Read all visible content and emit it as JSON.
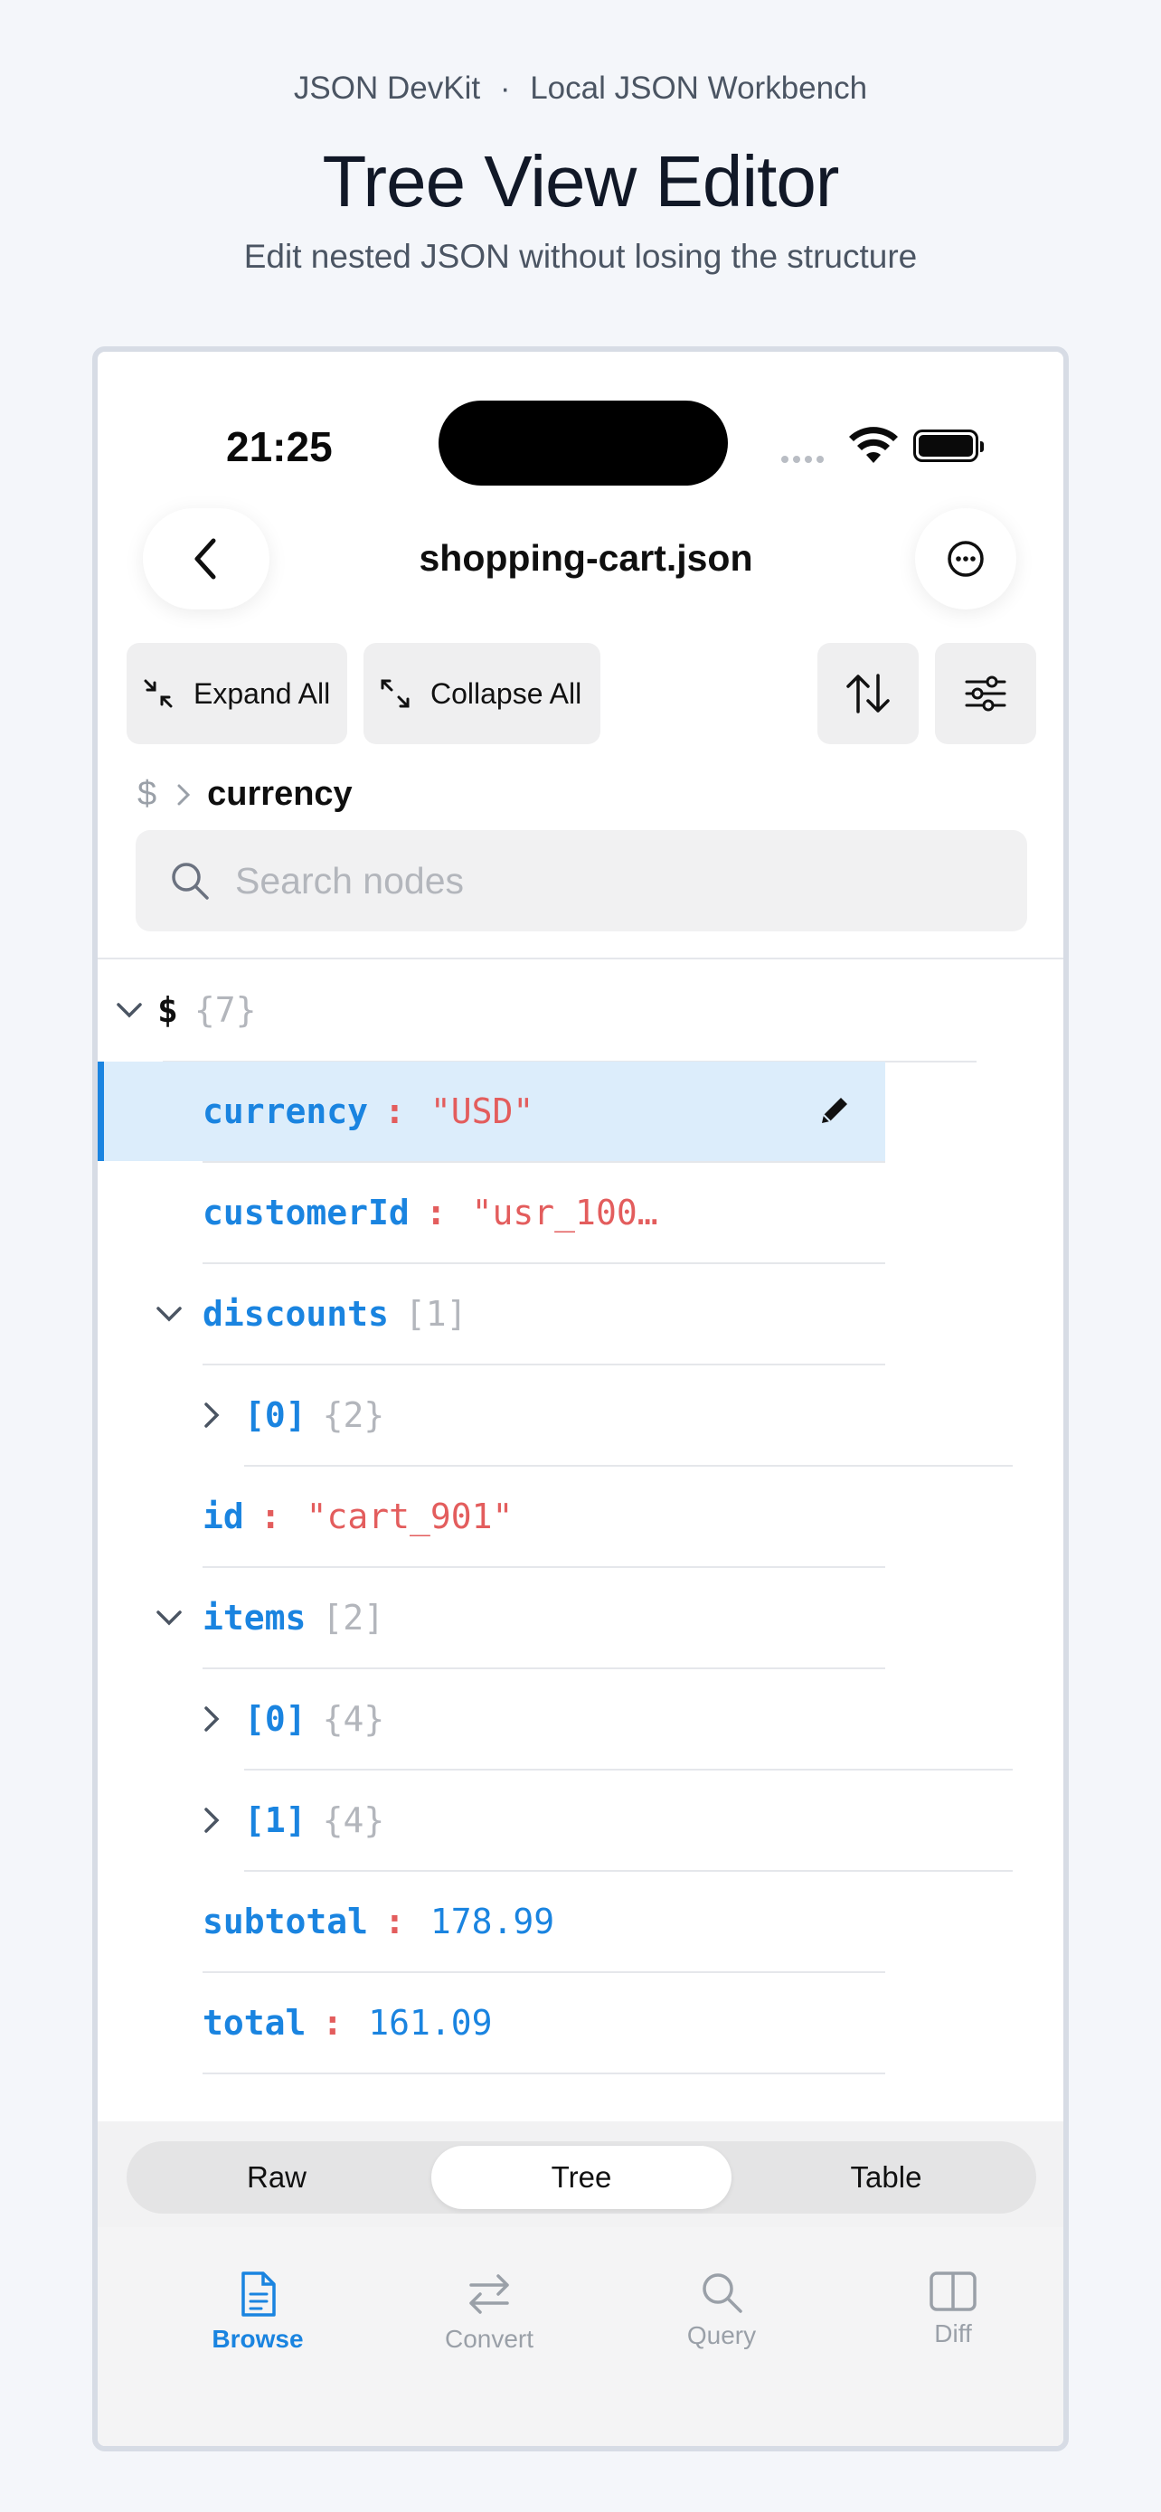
{
  "header": {
    "brand": "JSON DevKit",
    "brand_sep": "·",
    "brand_tag": "Local JSON Workbench",
    "title": "Tree View Editor",
    "subtitle": "Edit nested JSON without losing the structure"
  },
  "status": {
    "time": "21:25"
  },
  "nav": {
    "title": "shopping-cart.json",
    "back_icon": "chevron-left-icon",
    "more_icon": "ellipsis-circle-icon"
  },
  "toolbar": {
    "expand_label": "Expand All",
    "collapse_label": "Collapse All"
  },
  "breadcrumb": {
    "root": "$",
    "current": "currency"
  },
  "search": {
    "placeholder": "Search nodes"
  },
  "tree": {
    "root": {
      "key": "$",
      "count": "{7}"
    },
    "rows": [
      {
        "key": "currency",
        "sep": ":",
        "value": "\"USD\"",
        "selected": true
      },
      {
        "key": "customerId",
        "sep": ":",
        "value": "\"usr_100…"
      },
      {
        "key": "discounts",
        "count": "[1]"
      },
      {
        "key": "[0]",
        "count": "{2}"
      },
      {
        "key": "id",
        "sep": ":",
        "value": "\"cart_901\""
      },
      {
        "key": "items",
        "count": "[2]"
      },
      {
        "key": "[0]",
        "count": "{4}"
      },
      {
        "key": "[1]",
        "count": "{4}"
      },
      {
        "key": "subtotal",
        "sep": ":",
        "value": "178.99"
      },
      {
        "key": "total",
        "sep": ":",
        "value": "161.09"
      }
    ]
  },
  "segments": {
    "raw": "Raw",
    "tree": "Tree",
    "table": "Table",
    "active": "Tree"
  },
  "tabs": {
    "browse": "Browse",
    "convert": "Convert",
    "query": "Query",
    "diff": "Diff",
    "active": "Browse"
  },
  "colors": {
    "accent": "#1a84e0",
    "string": "#e35d5d",
    "selected_bg": "#dcedfb"
  }
}
